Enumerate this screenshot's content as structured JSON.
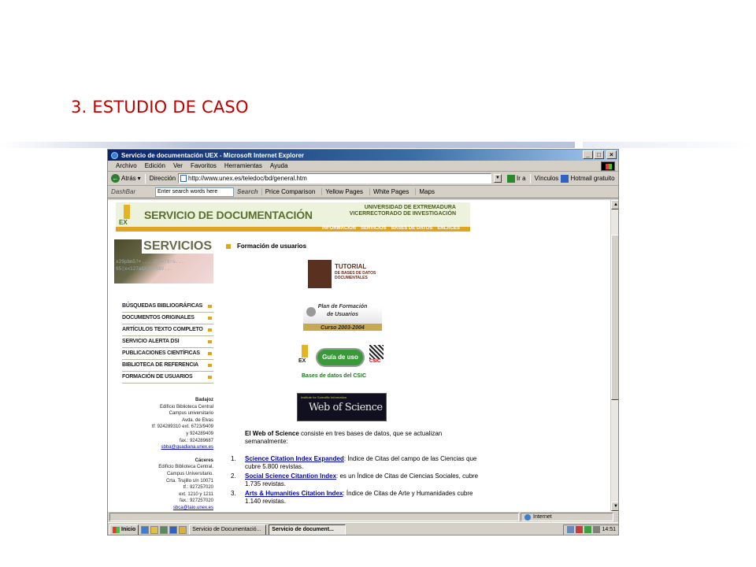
{
  "slide": {
    "title": "3. ESTUDIO DE CASO"
  },
  "window": {
    "title": "Servicio de documentación UEX - Microsoft Internet Explorer",
    "controls": {
      "minimize": "_",
      "maximize": "□",
      "close": "×"
    }
  },
  "menubar": [
    "Archivo",
    "Edición",
    "Ver",
    "Favoritos",
    "Herramientas",
    "Ayuda"
  ],
  "addressbar": {
    "back": "Atrás",
    "label": "Dirección",
    "url": "http://www.unex.es/teledoc/bd/general.htm",
    "go": "Ir a",
    "links": "Vínculos",
    "hotmail": "Hotmail gratuito"
  },
  "dashbar": {
    "dash": "DashBar",
    "search_placeholder": "Enter search words here",
    "search_button": "Search",
    "links": [
      "Price Comparison",
      "Yellow Pages",
      "White Pages",
      "Maps"
    ]
  },
  "page": {
    "banner": {
      "logo_text": "EX",
      "brand": "SERVICIO DE DOCUMENTACIÓN",
      "university": "UNIVERSIDAD DE EXTREMADURA",
      "vicerrectorado": "VICERRECTORADO DE INVESTIGACIÓN",
      "nav": [
        "INFORMACIÓN",
        "SERVICIOS",
        "BASES DE DATOS",
        "ENLACES"
      ]
    },
    "services_title": "SERVICIOS",
    "services_code": "x29pbm5?+... 2b5=?8r&... 95|x<127a&%?7?58V...",
    "menu": [
      "BÚSQUEDAS BIBLIOGRÁFICAS",
      "DOCUMENTOS ORIGINALES",
      "ARTÍCULOS TEXTO COMPLETO",
      "SERVICIO ALERTA DSI",
      "PUBLICACIONES CIENTÍFICAS",
      "BIBLIOTECA DE REFERENCIA",
      "FORMACIÓN DE USUARIOS"
    ],
    "badajoz": {
      "city": "Badajoz",
      "lines": [
        "Edificio Biblioteca Central",
        "Campus universitario",
        "Avda. de Elvas",
        "tf: 924289310 ext. 6723/9409",
        "y 924289409",
        "fax.: 924289687"
      ],
      "email": "sbba@guadiana.unex.es"
    },
    "caceres": {
      "city": "Cáceres",
      "lines": [
        "Edificio Biblioteca Central.",
        "Campus Universitario.",
        "Crta. Trujillo s/n 10071",
        "tf.: 927257020",
        "ext. 1210 y 1211",
        "fax.: 927257020"
      ],
      "email": "sbca@taio.unex.es"
    },
    "section_heading": "Formación de usuarios",
    "tutorial": {
      "title": "TUTORIAL",
      "subtitle": "DE BASES DE DATOS DOCUMENTALES"
    },
    "plan": {
      "line1": "Plan de Formación",
      "line2": "de Usuarios",
      "course": "Curso 2003-2004"
    },
    "guia": {
      "ex": "EX",
      "button": "Guía de uso",
      "csic": "CSIC",
      "caption": "Bases de datos del CSIC"
    },
    "wos": {
      "small": "Institute for Scientific Information",
      "title": "Web of Science"
    },
    "wos_intro_bold": "El Web of Science",
    "wos_intro_rest": " consiste en tres bases de datos, que se actualizan semanalmente:",
    "list": [
      {
        "num": "1.",
        "link": "Science Citation Index Expanded",
        "text": ": Índice de Citas del campo de las Ciencias que cubre 5.800 revistas."
      },
      {
        "num": "2.",
        "link": "Social Science Citantion Index",
        "text": ": es un Índice de Citas de Ciencias Sociales, cubre 1.735 revistas."
      },
      {
        "num": "3.",
        "link": "Arts & Humanities Citation Index",
        "text": ": Índice de Citas de Arte y Humanidades cubre 1.140 revistas."
      }
    ]
  },
  "statusbar": {
    "zone": "Internet"
  },
  "taskbar": {
    "start": "Inicio",
    "tasks": [
      "Servicio de Documentació...",
      "Servicio de document..."
    ],
    "clock": "14:51"
  },
  "colors": {
    "title_red": "#c00000",
    "ie_blue": "#0a246a",
    "uex_gold": "#e0a424",
    "uex_olive": "#5a6f2e"
  }
}
